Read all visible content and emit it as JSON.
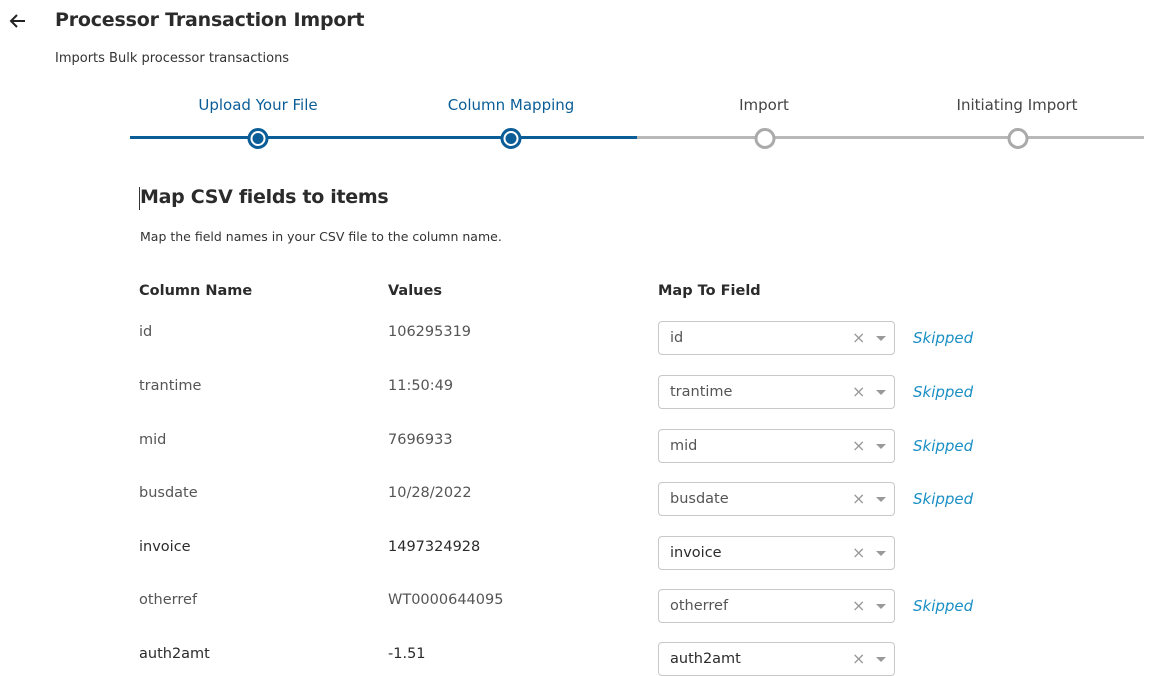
{
  "header": {
    "back_icon": "arrow-left-icon",
    "title": "Processor Transaction Import",
    "subtitle": "Imports Bulk processor transactions"
  },
  "stepper": {
    "steps": [
      {
        "label": "Upload Your File",
        "status": "done"
      },
      {
        "label": "Column Mapping",
        "status": "done"
      },
      {
        "label": "Import",
        "status": "pending"
      },
      {
        "label": "Initiating Import",
        "status": "pending"
      }
    ],
    "active_color": "#0b5d97",
    "inactive_color": "#aaaaaa"
  },
  "section": {
    "title": "Map CSV fields to items",
    "description": "Map the field names in your CSV file to the column name."
  },
  "table": {
    "headers": [
      "Column Name",
      "Values",
      "Map To Field"
    ],
    "rows": [
      {
        "column": "id",
        "value": "106295319",
        "mapped": "id",
        "status": "Skipped"
      },
      {
        "column": "trantime",
        "value": "11:50:49",
        "mapped": "trantime",
        "status": "Skipped"
      },
      {
        "column": "mid",
        "value": "7696933",
        "mapped": "mid",
        "status": "Skipped"
      },
      {
        "column": "busdate",
        "value": "10/28/2022",
        "mapped": "busdate",
        "status": "Skipped"
      },
      {
        "column": "invoice",
        "value": "1497324928",
        "mapped": "invoice",
        "status": ""
      },
      {
        "column": "otherref",
        "value": "WT0000644095",
        "mapped": "otherref",
        "status": "Skipped"
      },
      {
        "column": "auth2amt",
        "value": "-1.51",
        "mapped": "auth2amt",
        "status": ""
      }
    ],
    "clear_icon": "close-icon",
    "dropdown_icon": "caret-down-icon",
    "skipped_color": "#1a8fc4"
  }
}
